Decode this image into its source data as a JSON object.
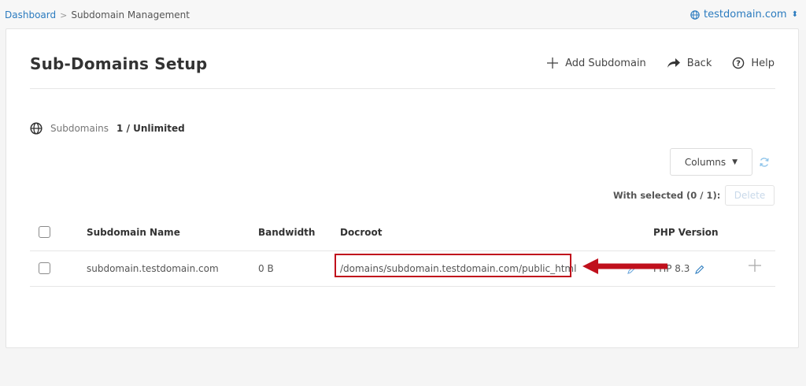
{
  "breadcrumb": {
    "home": "Dashboard",
    "separator": ">",
    "current": "Subdomain Management"
  },
  "domain_selector": {
    "value": "testdomain.com",
    "icon": "globe-icon"
  },
  "page": {
    "title": "Sub-Domains Setup",
    "actions": {
      "add": "Add Subdomain",
      "back": "Back",
      "help": "Help"
    }
  },
  "usage": {
    "label": "Subdomains",
    "value": "1 / Unlimited"
  },
  "toolbar": {
    "columns_label": "Columns",
    "with_selected": "With selected (0 / 1):",
    "delete_label": "Delete"
  },
  "table": {
    "headers": {
      "name": "Subdomain Name",
      "bandwidth": "Bandwidth",
      "docroot": "Docroot",
      "php": "PHP Version"
    },
    "rows": [
      {
        "name": "subdomain.testdomain.com",
        "bandwidth": "0 B",
        "docroot": "/domains/subdomain.testdomain.com/public_html",
        "php": "PHP 8.3"
      }
    ]
  },
  "colors": {
    "accent": "#2b7bbf",
    "annotation": "#c0101c"
  }
}
